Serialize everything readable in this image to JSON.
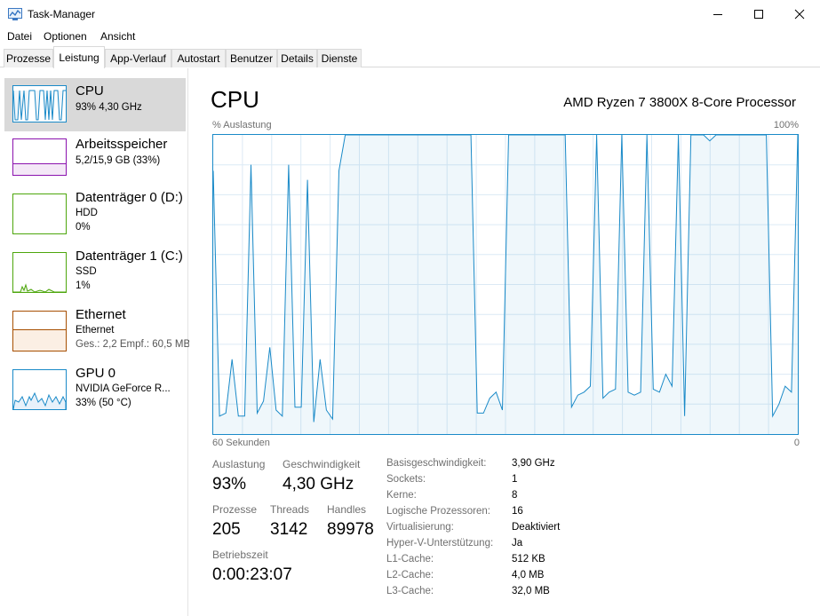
{
  "window": {
    "title": "Task-Manager"
  },
  "menu": [
    "Datei",
    "Optionen",
    "Ansicht"
  ],
  "tabs": [
    "Prozesse",
    "Leistung",
    "App-Verlauf",
    "Autostart",
    "Benutzer",
    "Details",
    "Dienste"
  ],
  "active_tab": "Leistung",
  "sidebar": [
    {
      "name": "CPU",
      "line1": "93% 4,30 GHz",
      "line2": "",
      "color": "#1a8ac8"
    },
    {
      "name": "Arbeitsspeicher",
      "line1": "5,2/15,9 GB (33%)",
      "line2": "",
      "color": "#8b12ae"
    },
    {
      "name": "Datenträger 0 (D:)",
      "line1": "HDD",
      "line2": "0%",
      "color": "#4da60c"
    },
    {
      "name": "Datenträger 1 (C:)",
      "line1": "SSD",
      "line2": "1%",
      "color": "#4da60c"
    },
    {
      "name": "Ethernet",
      "line1": "Ethernet",
      "line2": "Ges.: 2,2  Empf.: 60,5 MB",
      "color": "#a74f01"
    },
    {
      "name": "GPU 0",
      "line1": "NVIDIA GeForce R...",
      "line2": "33% (50 °C)",
      "color": "#1a8ac8"
    }
  ],
  "cpu": {
    "title": "CPU",
    "model": "AMD Ryzen 7 3800X 8-Core Processor",
    "graph_label_left": "% Auslastung",
    "graph_label_right": "100%",
    "time_left": "60 Sekunden",
    "time_right": "0",
    "auslastung_label": "Auslastung",
    "auslastung": "93%",
    "geschwindigkeit_label": "Geschwindigkeit",
    "geschwindigkeit": "4,30 GHz",
    "prozesse_label": "Prozesse",
    "prozesse": "205",
    "threads_label": "Threads",
    "threads": "3142",
    "handles_label": "Handles",
    "handles": "89978",
    "betriebszeit_label": "Betriebszeit",
    "betriebszeit": "0:00:23:07",
    "info": [
      {
        "label": "Basisgeschwindigkeit:",
        "value": "3,90 GHz"
      },
      {
        "label": "Sockets:",
        "value": "1"
      },
      {
        "label": "Kerne:",
        "value": "8"
      },
      {
        "label": "Logische Prozessoren:",
        "value": "16"
      },
      {
        "label": "Virtualisierung:",
        "value": "Deaktiviert"
      },
      {
        "label": "Hyper-V-Unterstützung:",
        "value": "Ja"
      },
      {
        "label": "L1-Cache:",
        "value": "512 KB"
      },
      {
        "label": "L2-Cache:",
        "value": "4,0 MB"
      },
      {
        "label": "L3-Cache:",
        "value": "32,0 MB"
      }
    ]
  },
  "chart_data": {
    "type": "area",
    "ylim": [
      0,
      100
    ],
    "values": [
      88,
      6,
      7,
      25,
      6,
      6,
      90,
      7,
      11,
      29,
      8,
      6,
      90,
      9,
      9,
      85,
      4,
      25,
      8,
      5,
      88,
      100,
      100,
      100,
      100,
      100,
      100,
      100,
      100,
      100,
      100,
      100,
      100,
      100,
      100,
      100,
      100,
      100,
      100,
      100,
      100,
      100,
      7,
      7,
      12,
      14,
      8,
      100,
      100,
      100,
      100,
      100,
      100,
      100,
      100,
      100,
      100,
      9,
      13,
      14,
      16,
      100,
      12,
      14,
      15,
      100,
      14,
      13,
      14,
      100,
      15,
      14,
      20,
      16,
      100,
      6,
      100,
      100,
      100,
      98,
      100,
      100,
      100,
      100,
      100,
      100,
      100,
      100,
      100,
      6,
      10,
      16,
      14,
      100
    ]
  }
}
